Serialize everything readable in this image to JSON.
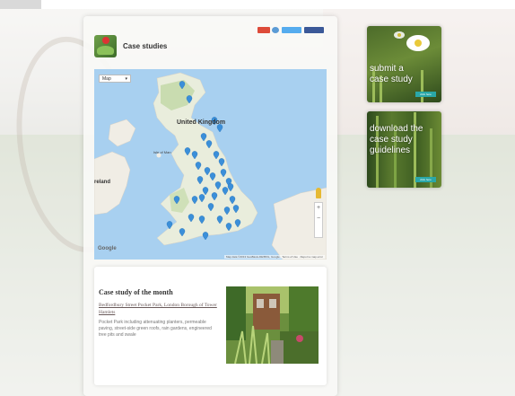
{
  "page": {
    "title": "Case studies",
    "share": {
      "twitter": "tweet",
      "facebook": "like"
    }
  },
  "map": {
    "type_selector": "Map",
    "country_label": "United Kingdom",
    "island_label": "Isle of Man",
    "ireland_label": "reland",
    "google_logo": "Google",
    "attribution": "Map data ©2013 GeoBasis-DE/BKG, Google · Terms of Use · Report a map error",
    "zoom_in": "+",
    "zoom_out": "−"
  },
  "case_of_month": {
    "heading": "Case study of the month",
    "link": "Bedfordbury Street Pocket Park, London Borough of Tower Hamlets",
    "description": "Pocket Park including attenuating planters, permeable paving, street-side green roofs, rain gardens, engineered tree pits and swale"
  },
  "tiles": [
    {
      "text": "submit a case study",
      "button": "click here"
    },
    {
      "text": "download the case study guidelines",
      "button": "click here"
    }
  ],
  "colors": {
    "water": "#a8d0f0",
    "land": "#f0ede5",
    "marker": "#3b8fd9",
    "button": "#2aa7a8"
  }
}
